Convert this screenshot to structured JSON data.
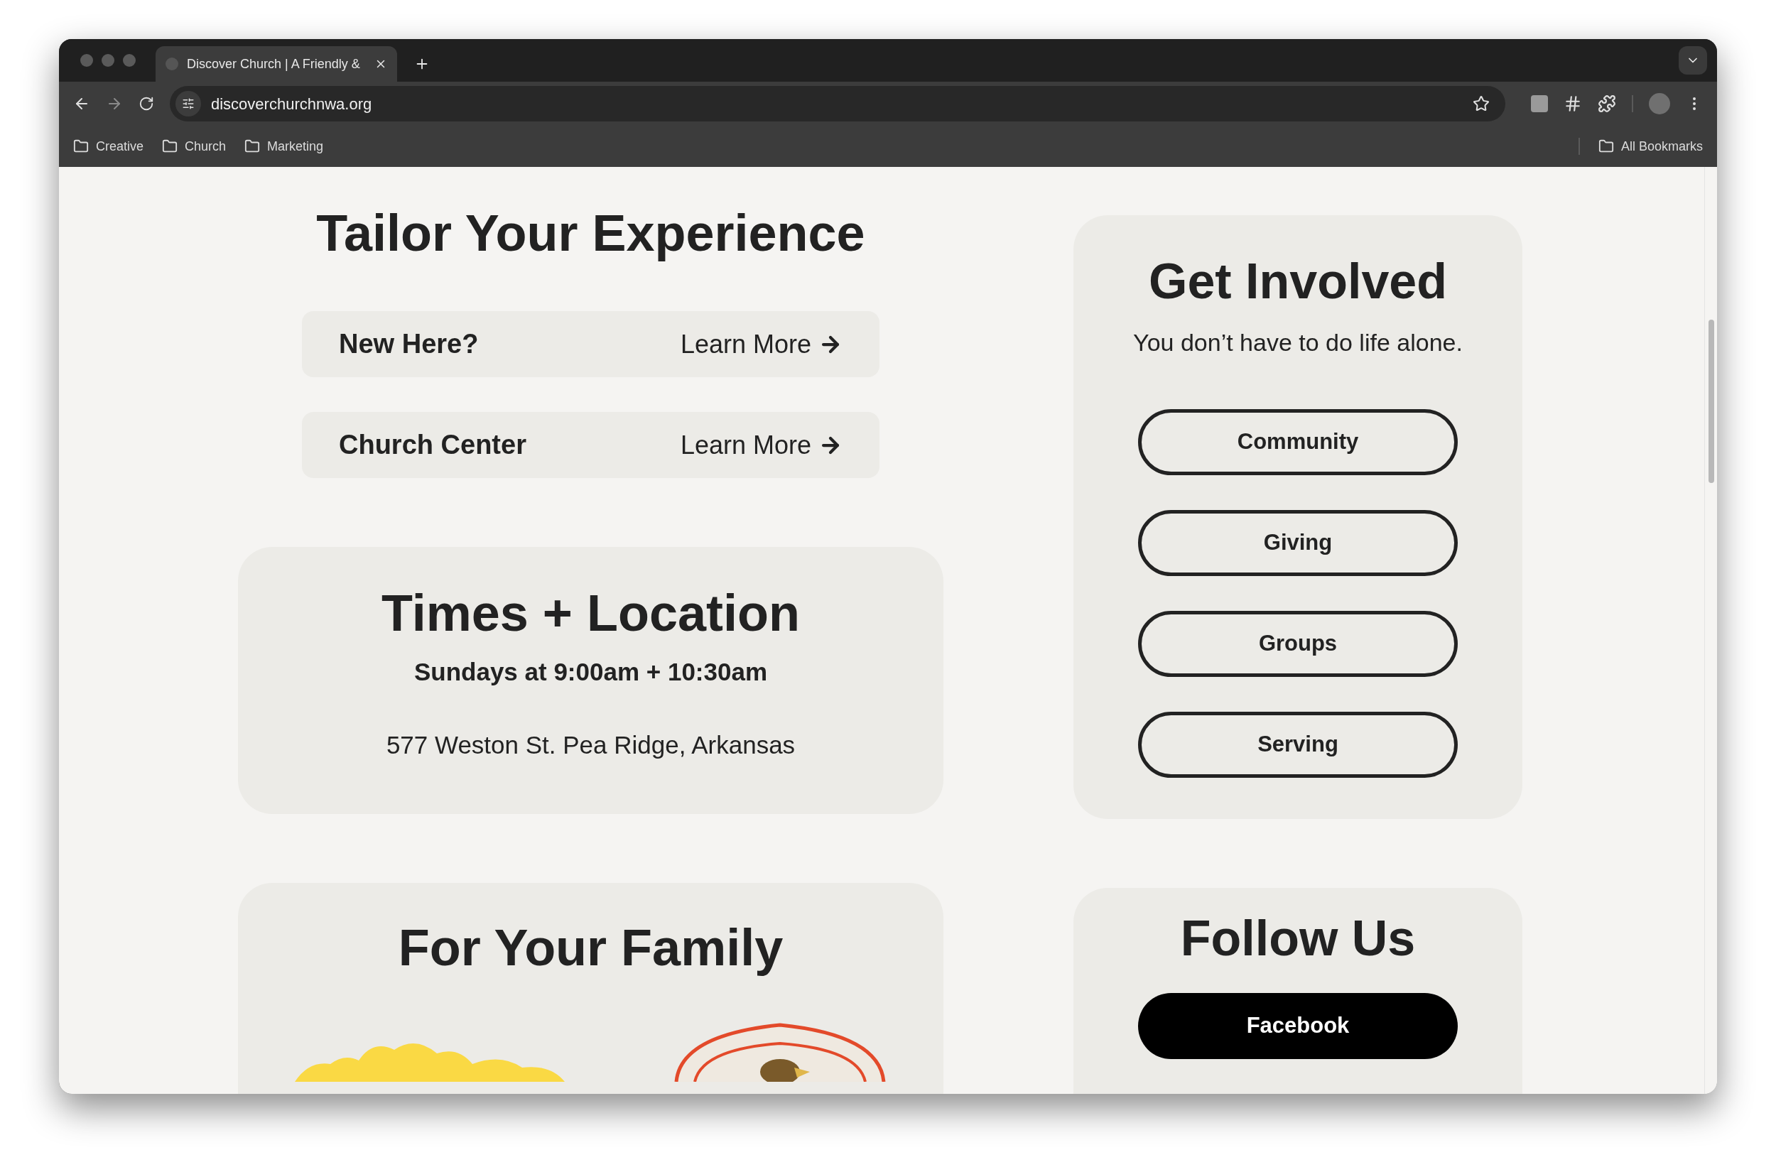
{
  "browser": {
    "tab_title": "Discover Church | A Friendly &",
    "url": "discoverchurchnwa.org",
    "forward_disabled": true,
    "bookmarks": [
      "Creative",
      "Church",
      "Marketing"
    ],
    "all_bookmarks": "All Bookmarks"
  },
  "tailor": {
    "title": "Tailor Your Experience",
    "links": [
      {
        "label": "New Here?",
        "action": "Learn More"
      },
      {
        "label": "Church Center",
        "action": "Learn More"
      }
    ]
  },
  "times": {
    "title": "Times + Location",
    "schedule": "Sundays at 9:00am + 10:30am",
    "address": "577 Weston St. Pea Ridge, Arkansas"
  },
  "family": {
    "title": "For Your Family"
  },
  "involved": {
    "title": "Get Involved",
    "subtitle": "You don’t have to do life alone.",
    "buttons": [
      "Community",
      "Giving",
      "Groups",
      "Serving"
    ]
  },
  "follow": {
    "title": "Follow Us",
    "buttons": [
      "Facebook"
    ]
  }
}
